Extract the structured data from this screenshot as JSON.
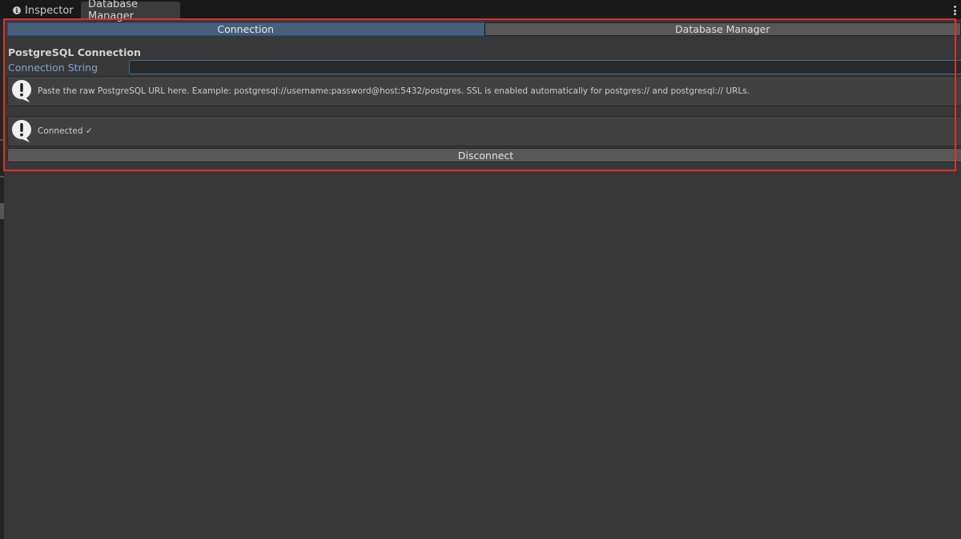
{
  "window": {
    "tabs": [
      {
        "label": "Inspector",
        "icon": "info-icon",
        "active": false
      },
      {
        "label": "Database Manager",
        "active": true
      }
    ],
    "menu_icon": "kebab-menu-icon"
  },
  "toolbar": {
    "items": [
      {
        "label": "Connection",
        "selected": true
      },
      {
        "label": "Database Manager",
        "selected": false
      }
    ]
  },
  "connection": {
    "section_title": "PostgreSQL Connection",
    "field_label": "Connection String",
    "field_value": "",
    "help": {
      "icon": "warning-speech-icon",
      "text": "Paste the raw PostgreSQL URL here. Example: postgresql://username:password@host:5432/postgres. SSL is enabled automatically for postgres:// and postgresql:// URLs."
    },
    "status": {
      "icon": "warning-speech-icon",
      "text": "Connected ✓"
    },
    "disconnect_label": "Disconnect"
  },
  "colors": {
    "background": "#383838",
    "tab_strip": "#191919",
    "active_toolbar": "#46607c",
    "label_accent": "#7ba3d8",
    "highlight": "#e0302a"
  }
}
